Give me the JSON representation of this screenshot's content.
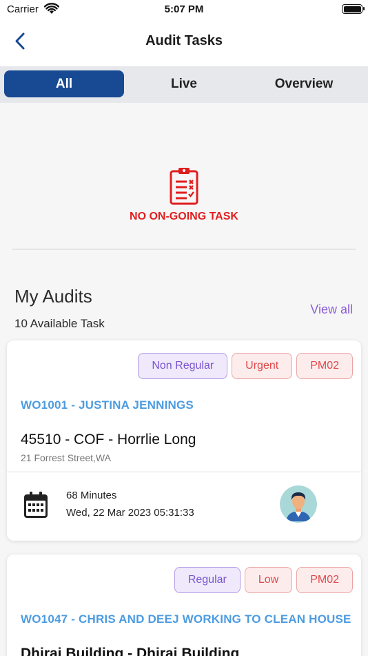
{
  "status_bar": {
    "carrier": "Carrier",
    "time": "5:07 PM"
  },
  "nav": {
    "title": "Audit Tasks"
  },
  "tabs": [
    {
      "label": "All",
      "active": true
    },
    {
      "label": "Live",
      "active": false
    },
    {
      "label": "Overview",
      "active": false
    }
  ],
  "ongoing": {
    "message": "NO ON-GOING TASK"
  },
  "my_audits": {
    "title": "My Audits",
    "subtitle": "10 Available Task",
    "view_all": "View all"
  },
  "tasks": [
    {
      "badges": [
        "Non Regular",
        "Urgent",
        "PM02"
      ],
      "work_order": "WO1001 - JUSTINA JENNINGS",
      "site": "45510 - COF - Horrlie Long",
      "address": "21 Forrest Street,WA",
      "duration": "68 Minutes",
      "datetime": "Wed, 22 Mar 2023 05:31:33"
    },
    {
      "badges": [
        "Regular",
        "Low",
        "PM02"
      ],
      "work_order": "WO1047 - CHRIS AND DEEJ WORKING TO CLEAN HOUSE",
      "site": "Dhiraj Building - Dhiraj Building"
    }
  ],
  "colors": {
    "primary": "#184a93",
    "accent_red": "#e01e1e",
    "link_blue": "#4c9be0",
    "view_all_purple": "#8b5fd6"
  },
  "icons": {
    "back": "chevron-left-icon",
    "empty": "clipboard-checklist-icon",
    "calendar": "calendar-icon",
    "avatar": "user-avatar"
  }
}
